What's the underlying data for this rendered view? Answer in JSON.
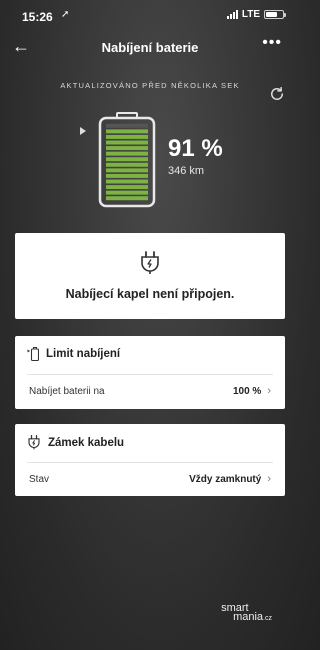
{
  "status_bar": {
    "time": "15:26",
    "network": "LTE"
  },
  "nav": {
    "title": "Nabíjení baterie"
  },
  "updated_text": "AKTUALIZOVÁNO PŘED NĚKOLIKA SEK",
  "battery": {
    "percent": "91 %",
    "range": "346 km",
    "level": 0.91,
    "bar_color": "#7cb342"
  },
  "cable_card": {
    "message": "Nabíjecí kapel není připojen."
  },
  "limit_card": {
    "title": "Limit nabíjení",
    "row_label": "Nabíjet baterii na",
    "row_value": "100 %"
  },
  "lock_card": {
    "title": "Zámek kabelu",
    "row_label": "Stav",
    "row_value": "Vždy zamknutý"
  },
  "logo": {
    "line1": "smart",
    "line2": "mania",
    "suffix": ".cz"
  }
}
